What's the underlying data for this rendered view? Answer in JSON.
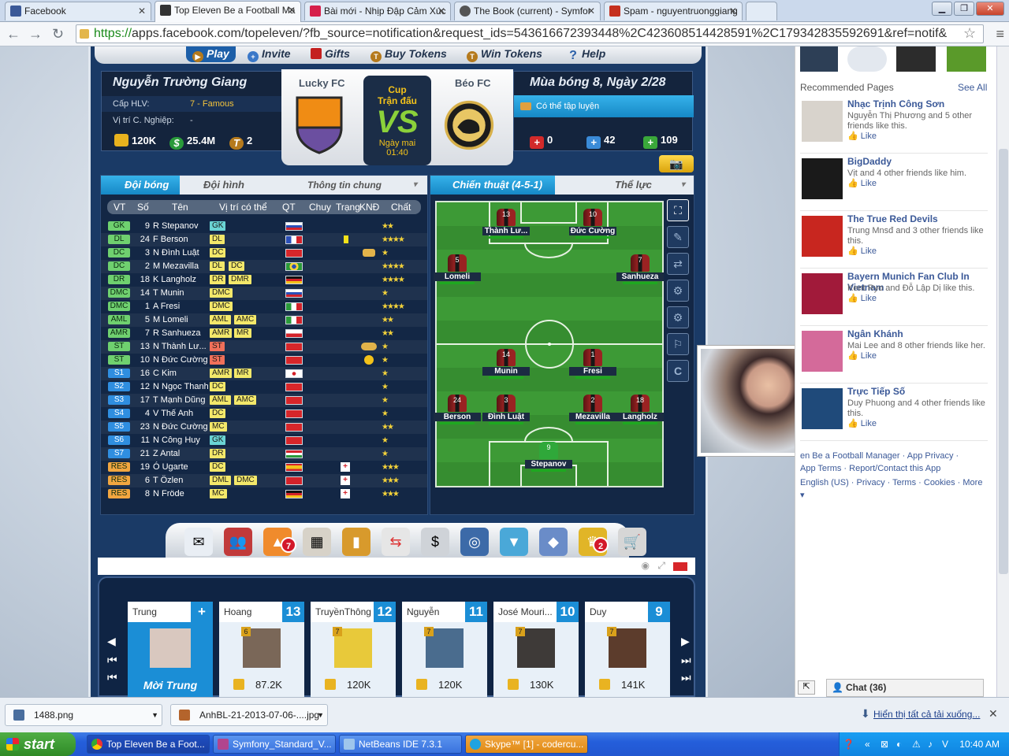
{
  "browser": {
    "tabs": [
      {
        "label": "Facebook",
        "color": "#3b5998"
      },
      {
        "label": "Top Eleven Be a Football Ma",
        "color": "#333333"
      },
      {
        "label": "Bài mới - Nhịp Đập Cảm Xúc",
        "color": "#d6204b"
      },
      {
        "label": "The Book (current) - Symfor",
        "color": "#555555"
      },
      {
        "label": "Spam - nguyentruonggiang",
        "color": "#c5301e"
      }
    ],
    "url_https": "https://",
    "url_rest": "apps.facebook.com/topeleven/?fb_source=notification&request_ids=543616672393448%2C423608514428591%2C179342835592691&ref=notif&"
  },
  "game": {
    "nav": [
      "Play",
      "Invite",
      "Gifts",
      "Buy Tokens",
      "Win Tokens",
      "Help"
    ],
    "manager": {
      "name": "Nguyễn Trường Giang",
      "level_label": "Cấp HLV:",
      "level_value": "7 - Famous",
      "career_label": "Vị trí C. Nghiệp:",
      "career_value": "-",
      "stat_money": "120K",
      "stat_cash": "25.4M",
      "stat_tokens": "2"
    },
    "match": {
      "home": "Lucky FC",
      "away": "Béo FC",
      "cup1": "Cup",
      "cup2": "Trận đấu",
      "vs": "VS",
      "date1": "Ngày mai",
      "date2": "01:40",
      "home_color": "#f08c14",
      "home_color2": "#6b4fa0"
    },
    "season": {
      "title": "Mùa bóng 8, Ngày 2/28",
      "training": "Có thể tập luyện",
      "injured": "0",
      "medical": "42",
      "fit": "109"
    },
    "squad": {
      "tab_team": "Đội bóng",
      "tab_lineup": "Đội hình",
      "tab_info": "Thông tin chung",
      "headers": [
        "VT",
        "Số",
        "Tên",
        "Vị trí có thể",
        "QT",
        "Chuy",
        "Trạng",
        "KNĐ",
        "Chất"
      ],
      "players": [
        {
          "vt": "GK",
          "num": "9",
          "name": "R Stepanov",
          "pos": [
            "GK"
          ],
          "flag": "ru",
          "stars": "★★",
          "stat": ""
        },
        {
          "vt": "DL",
          "num": "24",
          "name": "F Berson",
          "pos": [
            "DL"
          ],
          "flag": "fr",
          "stars": "★★★★",
          "stat": "card"
        },
        {
          "vt": "DC",
          "num": "3",
          "name": "N Đình Luật",
          "pos": [
            "DC"
          ],
          "flag": "vn",
          "stars": "★",
          "stat": "boot"
        },
        {
          "vt": "DC",
          "num": "2",
          "name": "M Mezavilla",
          "pos": [
            "DL",
            "DC"
          ],
          "flag": "br",
          "stars": "★★★★",
          "stat": ""
        },
        {
          "vt": "DR",
          "num": "18",
          "name": "K Langholz",
          "pos": [
            "DR",
            "DMR"
          ],
          "flag": "de",
          "stars": "★★★★",
          "stat": ""
        },
        {
          "vt": "DMC",
          "num": "14",
          "name": "T Munin",
          "pos": [
            "DMC"
          ],
          "flag": "ru",
          "stars": "★",
          "stat": ""
        },
        {
          "vt": "DMC",
          "num": "1",
          "name": "A Fresi",
          "pos": [
            "DMC"
          ],
          "flag": "it",
          "stars": "★★★★",
          "stat": ""
        },
        {
          "vt": "AML",
          "num": "5",
          "name": "M Lomeli",
          "pos": [
            "AML",
            "AMC"
          ],
          "flag": "mx",
          "stars": "★★",
          "stat": ""
        },
        {
          "vt": "AMR",
          "num": "7",
          "name": "R Sanhueza",
          "pos": [
            "AMR",
            "MR"
          ],
          "flag": "cl",
          "stars": "★★",
          "stat": ""
        },
        {
          "vt": "ST",
          "num": "13",
          "name": "N Thành Lư...",
          "pos": [
            "ST"
          ],
          "flag": "vn",
          "stars": "★",
          "stat": "grp"
        },
        {
          "vt": "ST",
          "num": "10",
          "name": "N Đức Cường",
          "pos": [
            "ST"
          ],
          "flag": "vn",
          "stars": "★",
          "stat": "smile"
        },
        {
          "vt": "S1",
          "num": "16",
          "name": "C Kim",
          "pos": [
            "AMR",
            "MR"
          ],
          "flag": "kr",
          "stars": "★",
          "stat": ""
        },
        {
          "vt": "S2",
          "num": "12",
          "name": "N Ngọc Thanh",
          "pos": [
            "DC"
          ],
          "flag": "vn",
          "stars": "★",
          "stat": ""
        },
        {
          "vt": "S3",
          "num": "17",
          "name": "T Mạnh Dũng",
          "pos": [
            "AML",
            "AMC"
          ],
          "flag": "vn",
          "stars": "★",
          "stat": ""
        },
        {
          "vt": "S4",
          "num": "4",
          "name": "V Thế Anh",
          "pos": [
            "DC"
          ],
          "flag": "vn",
          "stars": "★",
          "stat": ""
        },
        {
          "vt": "S5",
          "num": "23",
          "name": "N Đức Cường",
          "pos": [
            "MC"
          ],
          "flag": "vn",
          "stars": "★★",
          "stat": ""
        },
        {
          "vt": "S6",
          "num": "11",
          "name": "N Công Huy",
          "pos": [
            "GK"
          ],
          "flag": "vn",
          "stars": "★",
          "stat": ""
        },
        {
          "vt": "S7",
          "num": "21",
          "name": "Z Antal",
          "pos": [
            "DR"
          ],
          "flag": "hu",
          "stars": "★",
          "stat": ""
        },
        {
          "vt": "RES",
          "num": "19",
          "name": "Ó Ugarte",
          "pos": [
            "DC"
          ],
          "flag": "es",
          "stars": "★★★",
          "stat": "inj"
        },
        {
          "vt": "RES",
          "num": "6",
          "name": "T Özlen",
          "pos": [
            "DML",
            "DMC"
          ],
          "flag": "tr",
          "stars": "★★★",
          "stat": "inj"
        },
        {
          "vt": "RES",
          "num": "8",
          "name": "N Fröde",
          "pos": [
            "MC"
          ],
          "flag": "de",
          "stars": "★★★",
          "stat": "inj"
        }
      ]
    },
    "tactics": {
      "tab_tactics": "Chiến thuật (4-5-1)",
      "tab_fitness": "Thể lực",
      "pitch": [
        {
          "num": "13",
          "label": "Thành Lư...",
          "col": "st1"
        },
        {
          "num": "10",
          "label": "Đức Cường",
          "col": "st2"
        },
        {
          "num": "5",
          "label": "Lomeli",
          "col": "aml"
        },
        {
          "num": "7",
          "label": "Sanhueza",
          "col": "amr"
        },
        {
          "num": "14",
          "label": "Munin",
          "col": "dm1"
        },
        {
          "num": "1",
          "label": "Fresi",
          "col": "dm2"
        },
        {
          "num": "24",
          "label": "Berson",
          "col": "dl"
        },
        {
          "num": "3",
          "label": "Đình Luật",
          "col": "dc1"
        },
        {
          "num": "2",
          "label": "Mezavilla",
          "col": "dc2"
        },
        {
          "num": "18",
          "label": "Langholz",
          "col": "dr"
        },
        {
          "num": "9",
          "label": "Stepanov",
          "col": "gk"
        }
      ]
    },
    "bottom_badges": {
      "training": "7",
      "shop": "2"
    },
    "friends": [
      {
        "name": "Trung",
        "level": "+",
        "invite": "Mời Trung"
      },
      {
        "name": "Hoang",
        "level": "13",
        "lvl": "6",
        "pts": "87.2K"
      },
      {
        "name": "TruyềnThông",
        "level": "12",
        "lvl": "7",
        "pts": "120K"
      },
      {
        "name": "Nguyễn",
        "level": "11",
        "lvl": "7",
        "pts": "120K"
      },
      {
        "name": "José Mouri...",
        "level": "10",
        "lvl": "7",
        "pts": "130K"
      },
      {
        "name": "Duy",
        "level": "9",
        "lvl": "7",
        "pts": "141K"
      }
    ]
  },
  "facebook": {
    "recommended_label": "Recommended Pages",
    "see_all": "See All",
    "pages": [
      {
        "name": "Nhạc Trịnh Công Sơn",
        "desc": "Nguyễn Thị Phương and 5 other friends like this.",
        "like": "Like"
      },
      {
        "name": "BigDaddy",
        "desc": "Vịt and 4 other friends like him.",
        "like": "Like"
      },
      {
        "name": "The True Red Devils",
        "desc": "Trung Mnsđ and 3 other friends like this.",
        "like": "Like"
      },
      {
        "name": "Bayern Munich Fan Club In Vietnam",
        "desc": "Kent Ryo and Đỗ Lập Dị like this.",
        "like": "Like"
      },
      {
        "name": "Ngân Khánh",
        "desc": "Mai Lee and 8 other friends like her.",
        "like": "Like"
      },
      {
        "name": "Trực Tiếp Số",
        "desc": "Duy Phuong and 4 other friends like this.",
        "like": "Like"
      }
    ],
    "footer1": "en Be a Football Manager · App Privacy ·",
    "footer2": "App Terms · Report/Contact this App",
    "footer3": "English (US) · Privacy · Terms · Cookies · More ▾",
    "chat": "Chat (36)"
  },
  "downloads": {
    "file1": "1488.png",
    "file2": "AnhBL-21-2013-07-06-....jpg",
    "show_all": "Hiển thị tất cả tải xuống..."
  },
  "taskbar": {
    "start": "start",
    "items": [
      "Top Eleven Be a Foot...",
      "Symfony_Standard_V...",
      "NetBeans IDE 7.3.1",
      "Skype™ [1] - codercu..."
    ],
    "clock": "10:40 AM"
  }
}
